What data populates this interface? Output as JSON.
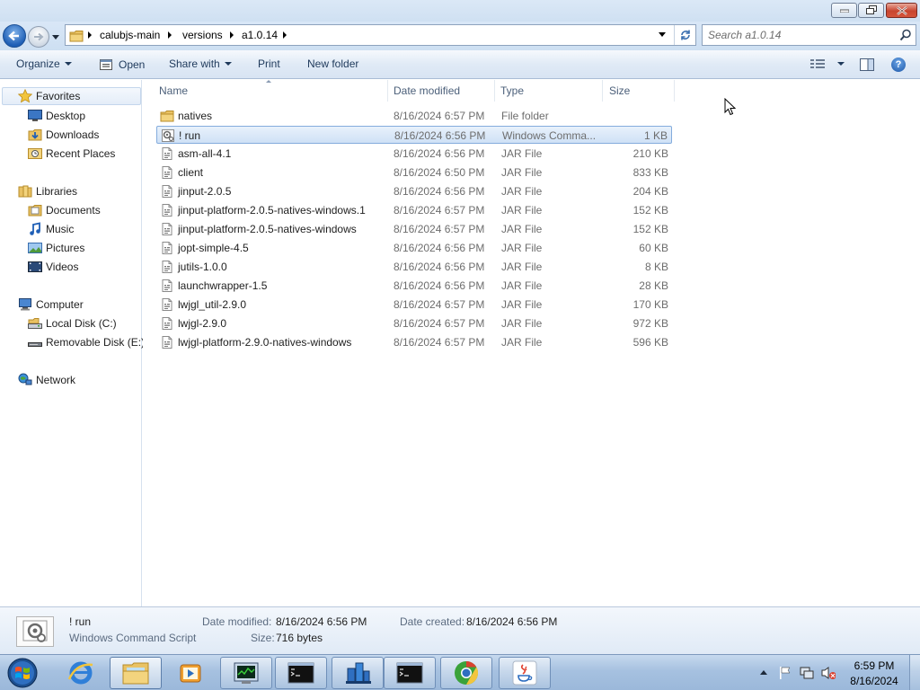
{
  "window": {
    "caption_buttons": {
      "minimize": "minimize",
      "maximize": "maximize",
      "close": "close"
    }
  },
  "address": {
    "breadcrumbs": [
      "calubjs-main",
      "versions",
      "a1.0.14"
    ],
    "search_placeholder": "Search a1.0.14"
  },
  "toolbar": {
    "organize": "Organize",
    "open": "Open",
    "share_with": "Share with",
    "print": "Print",
    "new_folder": "New folder"
  },
  "nav": {
    "favorites": "Favorites",
    "desktop": "Desktop",
    "downloads": "Downloads",
    "recent_places": "Recent Places",
    "libraries": "Libraries",
    "documents": "Documents",
    "music": "Music",
    "pictures": "Pictures",
    "videos": "Videos",
    "computer": "Computer",
    "local_disk": "Local Disk (C:)",
    "removable_disk": "Removable Disk (E:)",
    "network": "Network"
  },
  "columns": {
    "name": "Name",
    "date": "Date modified",
    "type": "Type",
    "size": "Size"
  },
  "files": [
    {
      "name": "natives",
      "date": "8/16/2024 6:57 PM",
      "type": "File folder",
      "size": "",
      "icon": "folder-icon",
      "selected": false
    },
    {
      "name": "! run",
      "date": "8/16/2024 6:56 PM",
      "type": "Windows Comma...",
      "size": "1 KB",
      "icon": "script-icon",
      "selected": true
    },
    {
      "name": "asm-all-4.1",
      "date": "8/16/2024 6:56 PM",
      "type": "JAR File",
      "size": "210 KB",
      "icon": "jar-file-icon",
      "selected": false
    },
    {
      "name": "client",
      "date": "8/16/2024 6:50 PM",
      "type": "JAR File",
      "size": "833 KB",
      "icon": "jar-file-icon",
      "selected": false
    },
    {
      "name": "jinput-2.0.5",
      "date": "8/16/2024 6:56 PM",
      "type": "JAR File",
      "size": "204 KB",
      "icon": "jar-file-icon",
      "selected": false
    },
    {
      "name": "jinput-platform-2.0.5-natives-windows.1",
      "date": "8/16/2024 6:57 PM",
      "type": "JAR File",
      "size": "152 KB",
      "icon": "jar-file-icon",
      "selected": false
    },
    {
      "name": "jinput-platform-2.0.5-natives-windows",
      "date": "8/16/2024 6:57 PM",
      "type": "JAR File",
      "size": "152 KB",
      "icon": "jar-file-icon",
      "selected": false
    },
    {
      "name": "jopt-simple-4.5",
      "date": "8/16/2024 6:56 PM",
      "type": "JAR File",
      "size": "60 KB",
      "icon": "jar-file-icon",
      "selected": false
    },
    {
      "name": "jutils-1.0.0",
      "date": "8/16/2024 6:56 PM",
      "type": "JAR File",
      "size": "8 KB",
      "icon": "jar-file-icon",
      "selected": false
    },
    {
      "name": "launchwrapper-1.5",
      "date": "8/16/2024 6:56 PM",
      "type": "JAR File",
      "size": "28 KB",
      "icon": "jar-file-icon",
      "selected": false
    },
    {
      "name": "lwjgl_util-2.9.0",
      "date": "8/16/2024 6:57 PM",
      "type": "JAR File",
      "size": "170 KB",
      "icon": "jar-file-icon",
      "selected": false
    },
    {
      "name": "lwjgl-2.9.0",
      "date": "8/16/2024 6:57 PM",
      "type": "JAR File",
      "size": "972 KB",
      "icon": "jar-file-icon",
      "selected": false
    },
    {
      "name": "lwjgl-platform-2.9.0-natives-windows",
      "date": "8/16/2024 6:57 PM",
      "type": "JAR File",
      "size": "596 KB",
      "icon": "jar-file-icon",
      "selected": false
    }
  ],
  "details": {
    "name": "! run",
    "type": "Windows Command Script",
    "date_modified_label": "Date modified:",
    "date_modified": "8/16/2024 6:56 PM",
    "size_label": "Size:",
    "size": "716 bytes",
    "date_created_label": "Date created:",
    "date_created": "8/16/2024 6:56 PM"
  },
  "taskbar": {
    "apps": [
      "internet-explorer-icon",
      "windows-explorer-icon",
      "media-player-icon",
      "task-manager-icon",
      "command-prompt-icon",
      "network-tool-icon",
      "command-prompt-icon",
      "chrome-icon",
      "java-icon"
    ],
    "clock_time": "6:59 PM",
    "clock_date": "8/16/2024"
  },
  "colors": {
    "selection": "#cfe1f6",
    "selection_border": "#84acdd",
    "command_bar": "#e0eaf6",
    "taskbar": "#a6c1e0",
    "close_button": "#c8452f"
  }
}
